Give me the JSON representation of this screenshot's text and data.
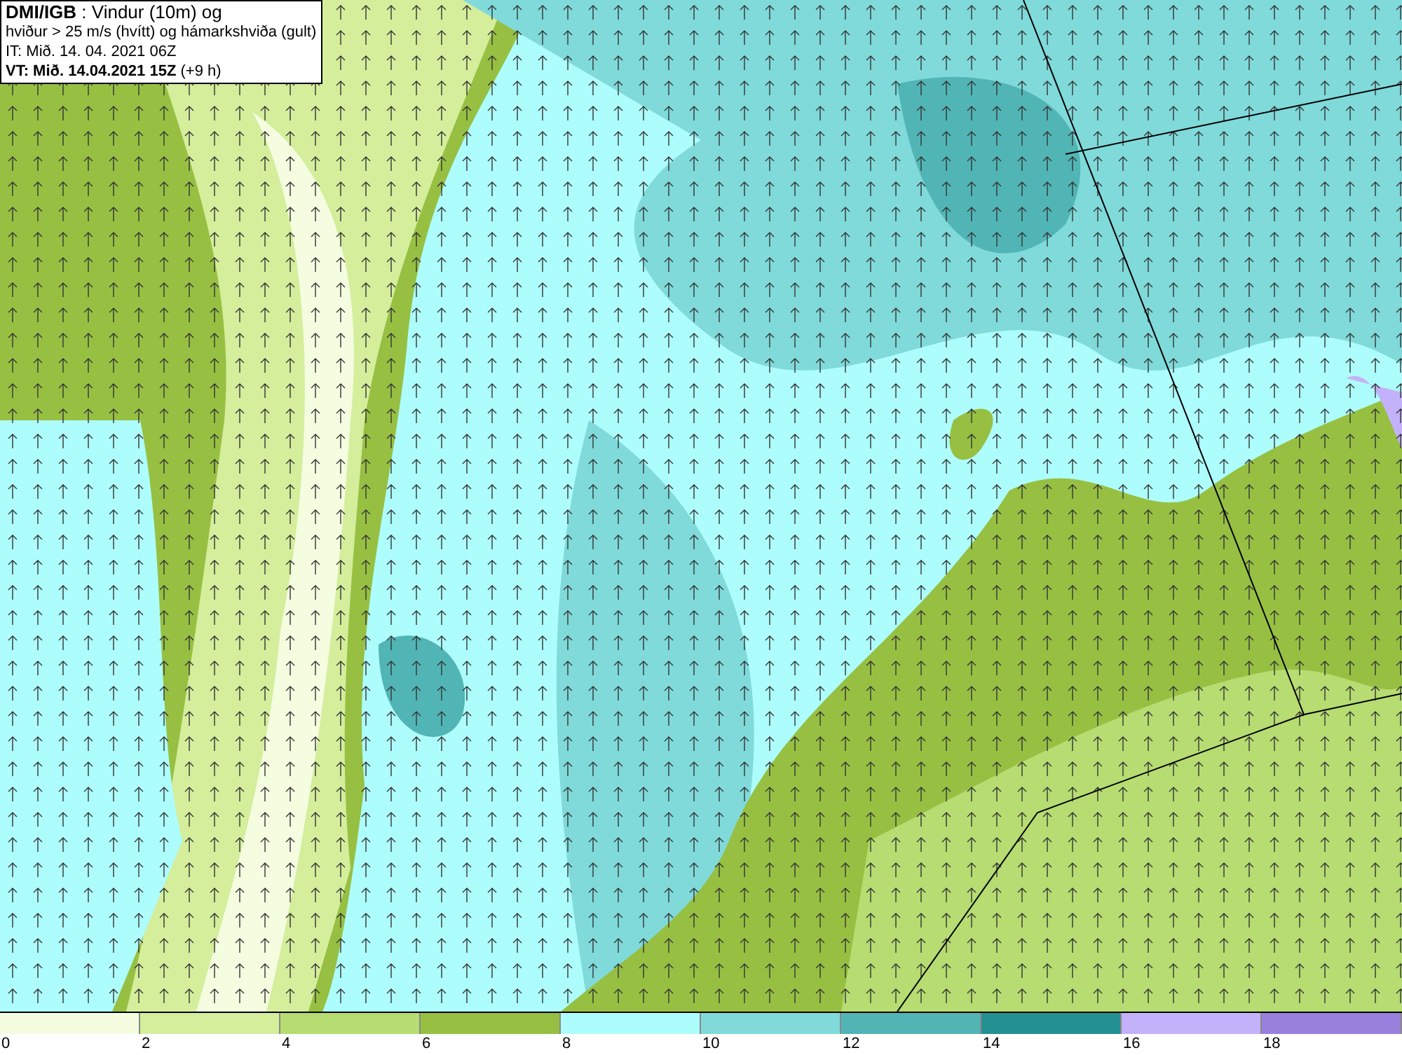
{
  "info_box": {
    "lines": [
      "**DMI/IGB** : Vindur (10m) og",
      "hviður > 25 m/s (hvítt) og hámarkshviða (gult)",
      "IT: Mið. 14. 04. 2021 06Z",
      "**VT: Mið. 14.04.2021 15Z** (+9 h)"
    ]
  },
  "legend": [
    {
      "label": "0",
      "color": "#f4fde0"
    },
    {
      "label": "2",
      "color": "#d4ee9c"
    },
    {
      "label": "4",
      "color": "#b6dc72"
    },
    {
      "label": "6",
      "color": "#97c043"
    },
    {
      "label": "8",
      "color": "#aefdfd"
    },
    {
      "label": "10",
      "color": "#80dada"
    },
    {
      "label": "12",
      "color": "#52b5b5"
    },
    {
      "label": "14",
      "color": "#239191"
    },
    {
      "label": "16",
      "color": "#c3b2f9"
    },
    {
      "label": "18",
      "color": "#9a80dd"
    }
  ]
}
